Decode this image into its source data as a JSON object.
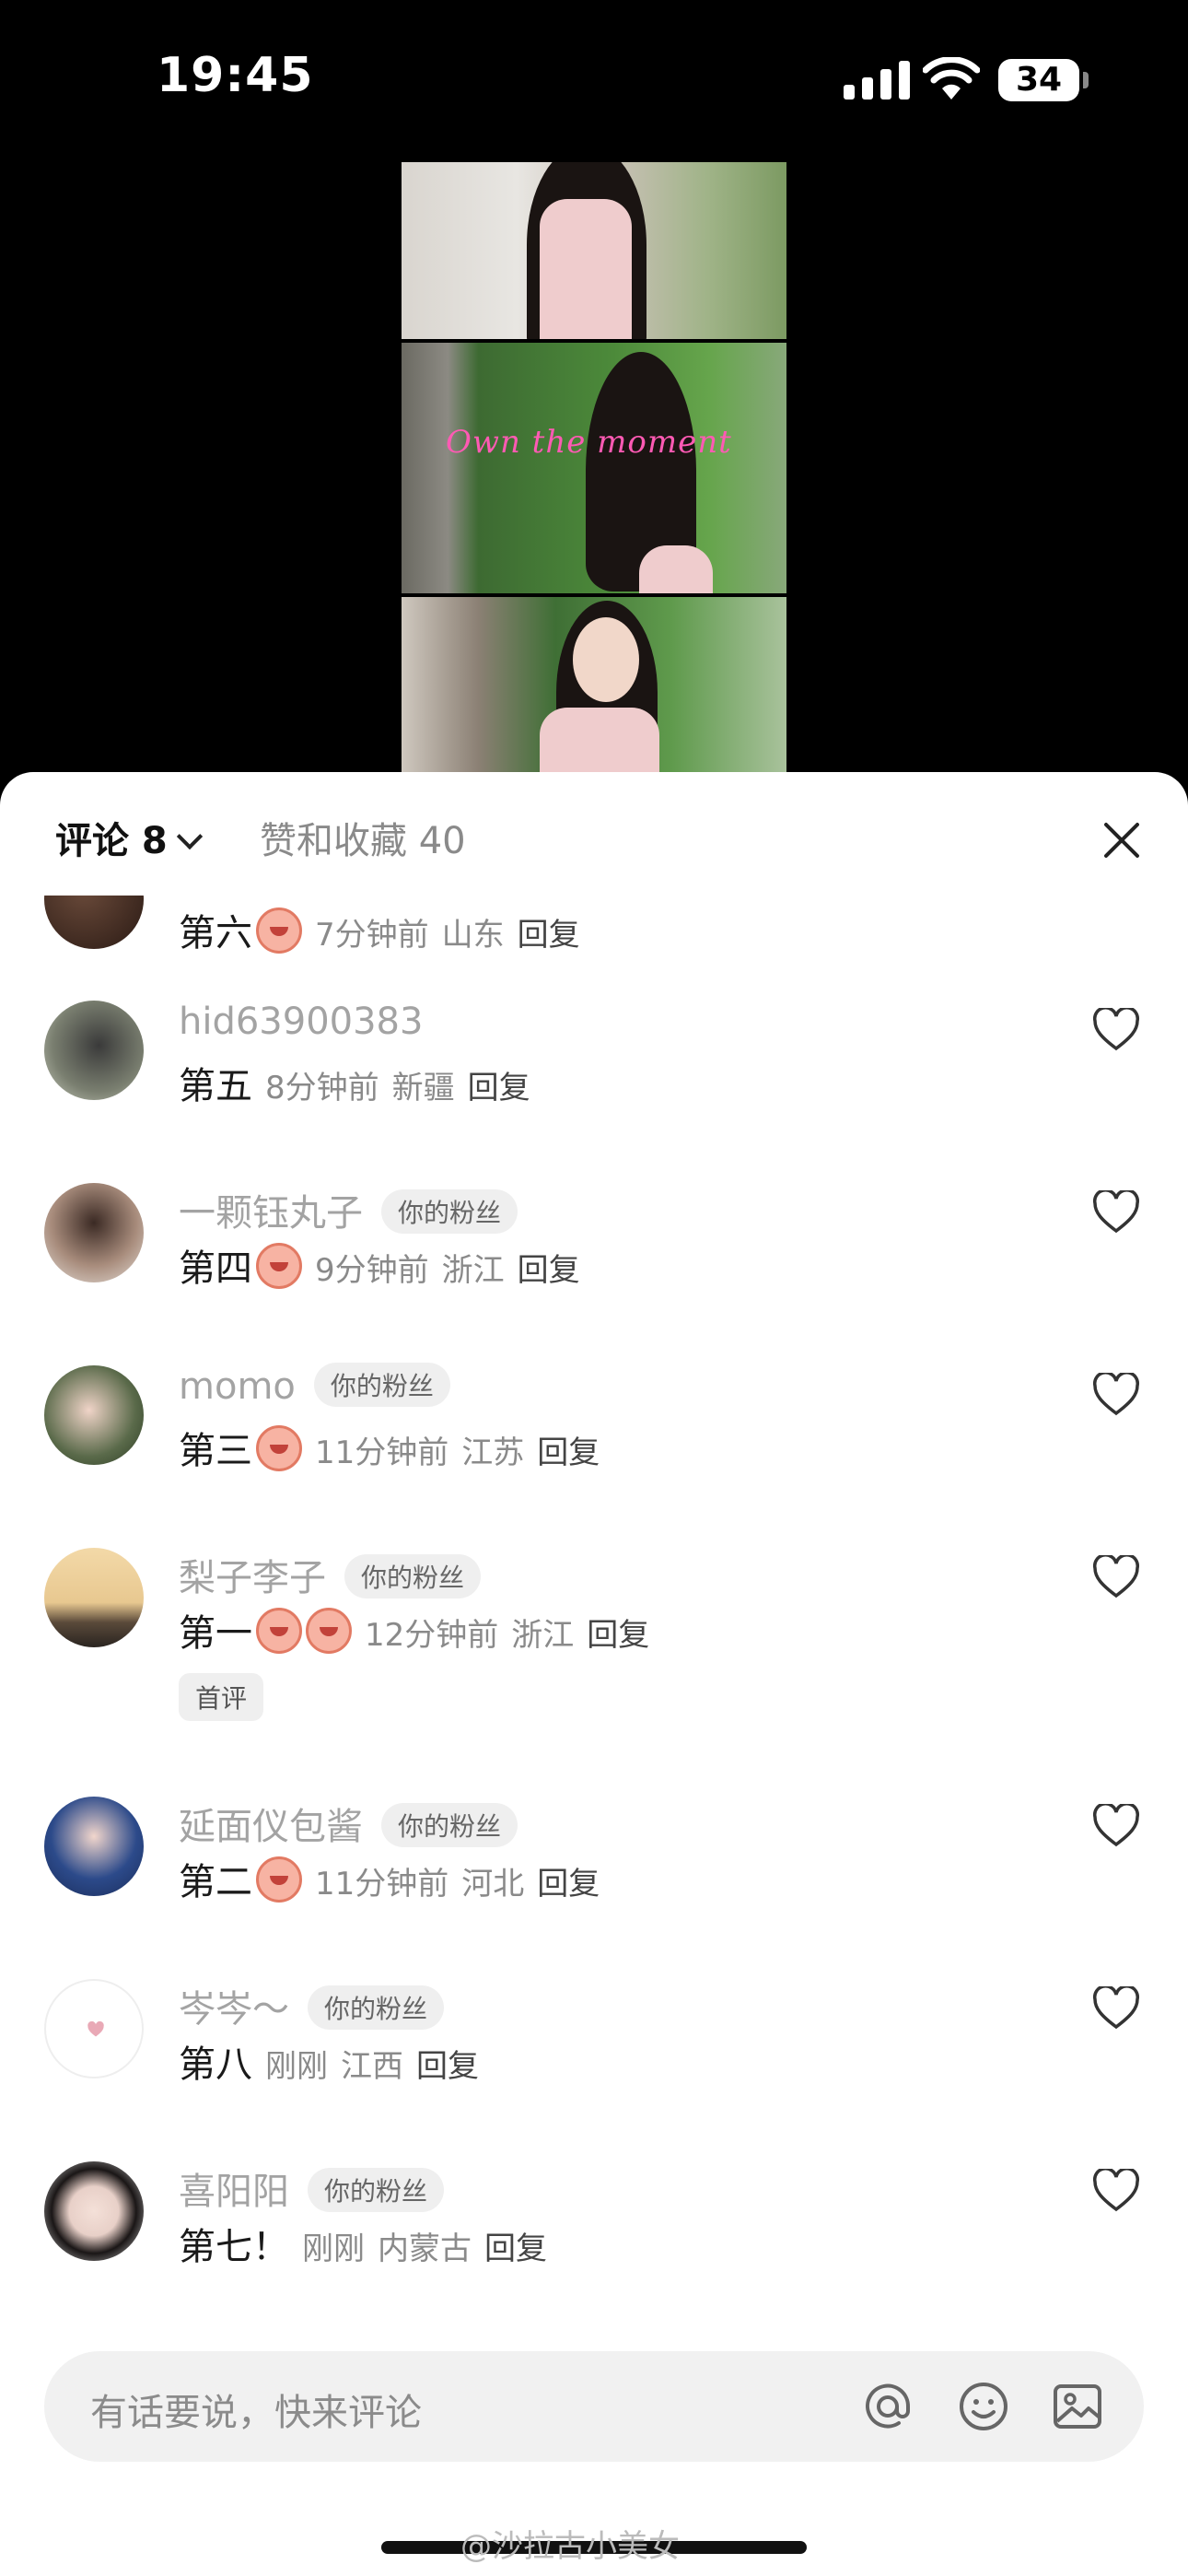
{
  "status": {
    "time": "19:45",
    "battery": "34"
  },
  "video": {
    "overlay_text": "Own the moment"
  },
  "sheet": {
    "tabs": {
      "comments_label": "评论 8",
      "likes_label": "赞和收藏 40"
    }
  },
  "comments": [
    {
      "name": "",
      "badge": "",
      "text": "第六",
      "time": "7分钟前",
      "location": "山东",
      "reply": "回复"
    },
    {
      "name": "hid63900383",
      "badge": "",
      "text": "第五",
      "time": "8分钟前",
      "location": "新疆",
      "reply": "回复"
    },
    {
      "name": "一颗钰丸子",
      "badge": "你的粉丝",
      "text": "第四",
      "time": "9分钟前",
      "location": "浙江",
      "reply": "回复"
    },
    {
      "name": "momo",
      "badge": "你的粉丝",
      "text": "第三",
      "time": "11分钟前",
      "location": "江苏",
      "reply": "回复"
    },
    {
      "name": "梨子李子",
      "badge": "你的粉丝",
      "text": "第一",
      "time": "12分钟前",
      "location": "浙江",
      "reply": "回复",
      "tag": "首评"
    },
    {
      "name": "延面仪包酱",
      "badge": "你的粉丝",
      "text": "第二",
      "time": "11分钟前",
      "location": "河北",
      "reply": "回复"
    },
    {
      "name": "岑岑～",
      "badge": "你的粉丝",
      "text": "第八",
      "time": "刚刚",
      "location": "江西",
      "reply": "回复"
    },
    {
      "name": "喜阳阳",
      "badge": "你的粉丝",
      "text": "第七！",
      "time": "刚刚",
      "location": "内蒙古",
      "reply": "回复"
    }
  ],
  "input": {
    "placeholder": "有话要说，快来评论"
  },
  "watermark": "@沙拉古小美女",
  "icons": [
    "signal-icon",
    "wifi-icon",
    "battery-icon",
    "chevron-down-icon",
    "close-icon",
    "heart-icon",
    "at-icon",
    "emoji-icon",
    "image-icon"
  ],
  "colors": {
    "accent_overlay": "#ff5ab4",
    "sheet_bg": "#ffffff",
    "input_bg": "#f1f1f1"
  }
}
